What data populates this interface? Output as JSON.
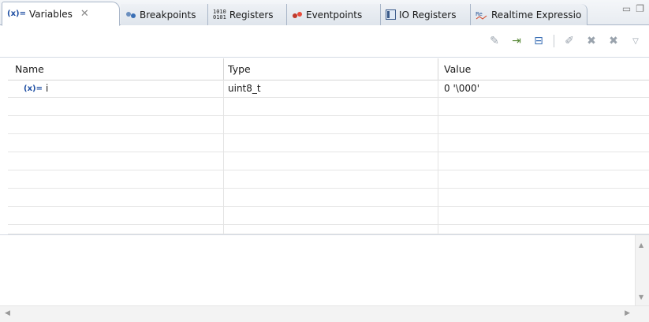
{
  "tabs": [
    {
      "label": "Variables",
      "icon": "variables-icon",
      "active": true
    },
    {
      "label": "Breakpoints",
      "icon": "breakpoints-icon"
    },
    {
      "label": "Registers",
      "icon": "registers-icon"
    },
    {
      "label": "Eventpoints",
      "icon": "eventpoints-icon"
    },
    {
      "label": "IO Registers",
      "icon": "io-registers-icon"
    },
    {
      "label": "Realtime Expressio",
      "icon": "realtime-expression-icon"
    }
  ],
  "table": {
    "headers": {
      "name": "Name",
      "type": "Type",
      "value": "Value"
    },
    "rows": [
      {
        "name": "i",
        "type": "uint8_t",
        "value": "0 '\\000'"
      }
    ]
  },
  "colors": {
    "tab_border": "#a9b6c8",
    "var_icon": "#1f4fa3"
  }
}
